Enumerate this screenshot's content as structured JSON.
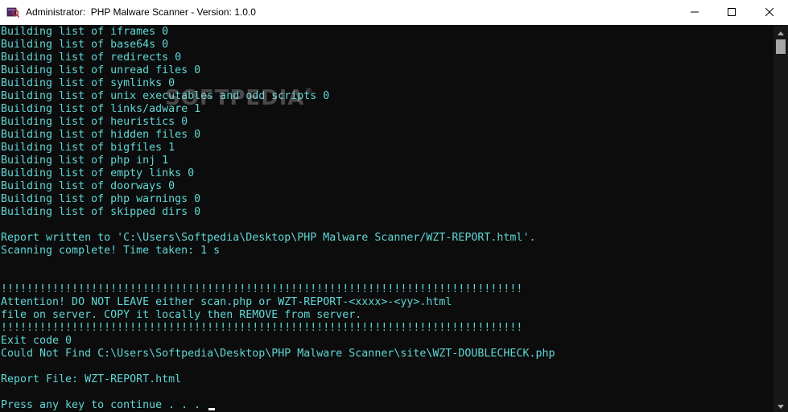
{
  "window": {
    "title": "Administrator:  PHP Malware Scanner - Version: 1.0.0",
    "icon": "console-app-icon",
    "controls": {
      "minimize": "minimize-icon",
      "maximize": "maximize-icon",
      "close": "close-icon"
    }
  },
  "console": {
    "lines": [
      "Building list of iframes 0",
      "Building list of base64s 0",
      "Building list of redirects 0",
      "Building list of unread files 0",
      "Building list of symlinks 0",
      "Building list of unix executables and odd scripts 0",
      "Building list of links/adware 1",
      "Building list of heuristics 0",
      "Building list of hidden files 0",
      "Building list of bigfiles 1",
      "Building list of php inj 1",
      "Building list of empty links 0",
      "Building list of doorways 0",
      "Building list of php warnings 0",
      "Building list of skipped dirs 0",
      "",
      "Report written to 'C:\\Users\\Softpedia\\Desktop\\PHP Malware Scanner/WZT-REPORT.html'.",
      "Scanning complete! Time taken: 1 s",
      "",
      "",
      "!!!!!!!!!!!!!!!!!!!!!!!!!!!!!!!!!!!!!!!!!!!!!!!!!!!!!!!!!!!!!!!!!!!!!!!!!!!!!!!!!",
      "Attention! DO NOT LEAVE either scan.php or WZT-REPORT-<xxxx>-<yy>.html",
      "file on server. COPY it locally then REMOVE from server.",
      "!!!!!!!!!!!!!!!!!!!!!!!!!!!!!!!!!!!!!!!!!!!!!!!!!!!!!!!!!!!!!!!!!!!!!!!!!!!!!!!!!",
      "Exit code 0",
      "Could Not Find C:\\Users\\Softpedia\\Desktop\\PHP Malware Scanner\\site\\WZT-DOUBLECHECK.php",
      "",
      "Report File: WZT-REPORT.html",
      "",
      "Press any key to continue . . . "
    ]
  },
  "watermark": {
    "text": "SOFTPEDIA",
    "mark": "®"
  },
  "colors": {
    "console_bg": "#0c0c0c",
    "console_text": "#61d6d6",
    "titlebar_bg": "#ffffff",
    "scrollbar_thumb": "#a6a6a6"
  }
}
